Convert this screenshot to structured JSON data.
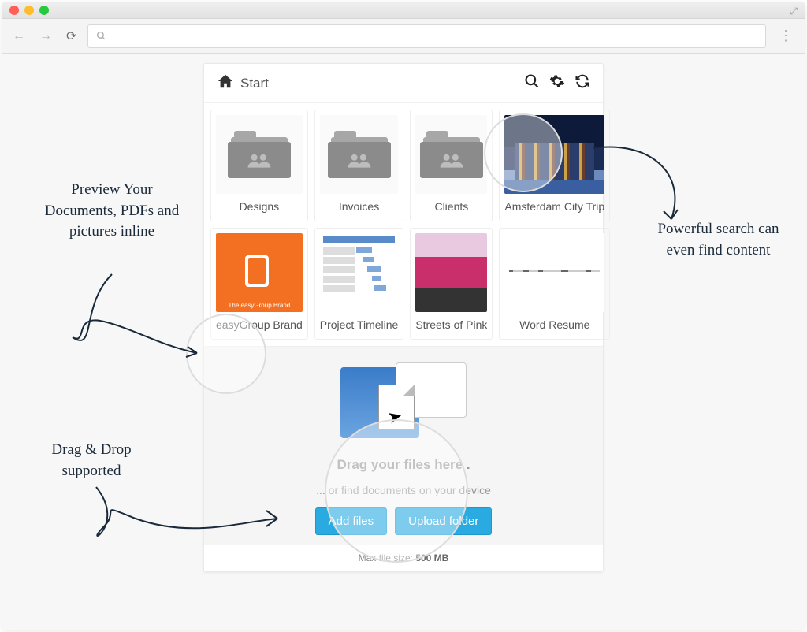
{
  "breadcrumb": "Start",
  "tiles": [
    {
      "label": "Designs"
    },
    {
      "label": "Invoices"
    },
    {
      "label": "Clients"
    },
    {
      "label": "Amsterdam City Trip"
    },
    {
      "label": "easyGroup Brand"
    },
    {
      "label": "Project Timeline"
    },
    {
      "label": "Streets of Pink"
    },
    {
      "label": "Word Resume"
    }
  ],
  "drop": {
    "title": "Drag your files here .",
    "sub": "... or find documents on your device",
    "add": "Add files",
    "upload": "Upload folder"
  },
  "maxsize_prefix": "Max file size: ",
  "maxsize_value": "500 MB",
  "annotations": {
    "preview": "Preview Your Documents, PDFs and pictures inline",
    "search": "Powerful search can even find content",
    "dragdrop": "Drag & Drop supported"
  }
}
